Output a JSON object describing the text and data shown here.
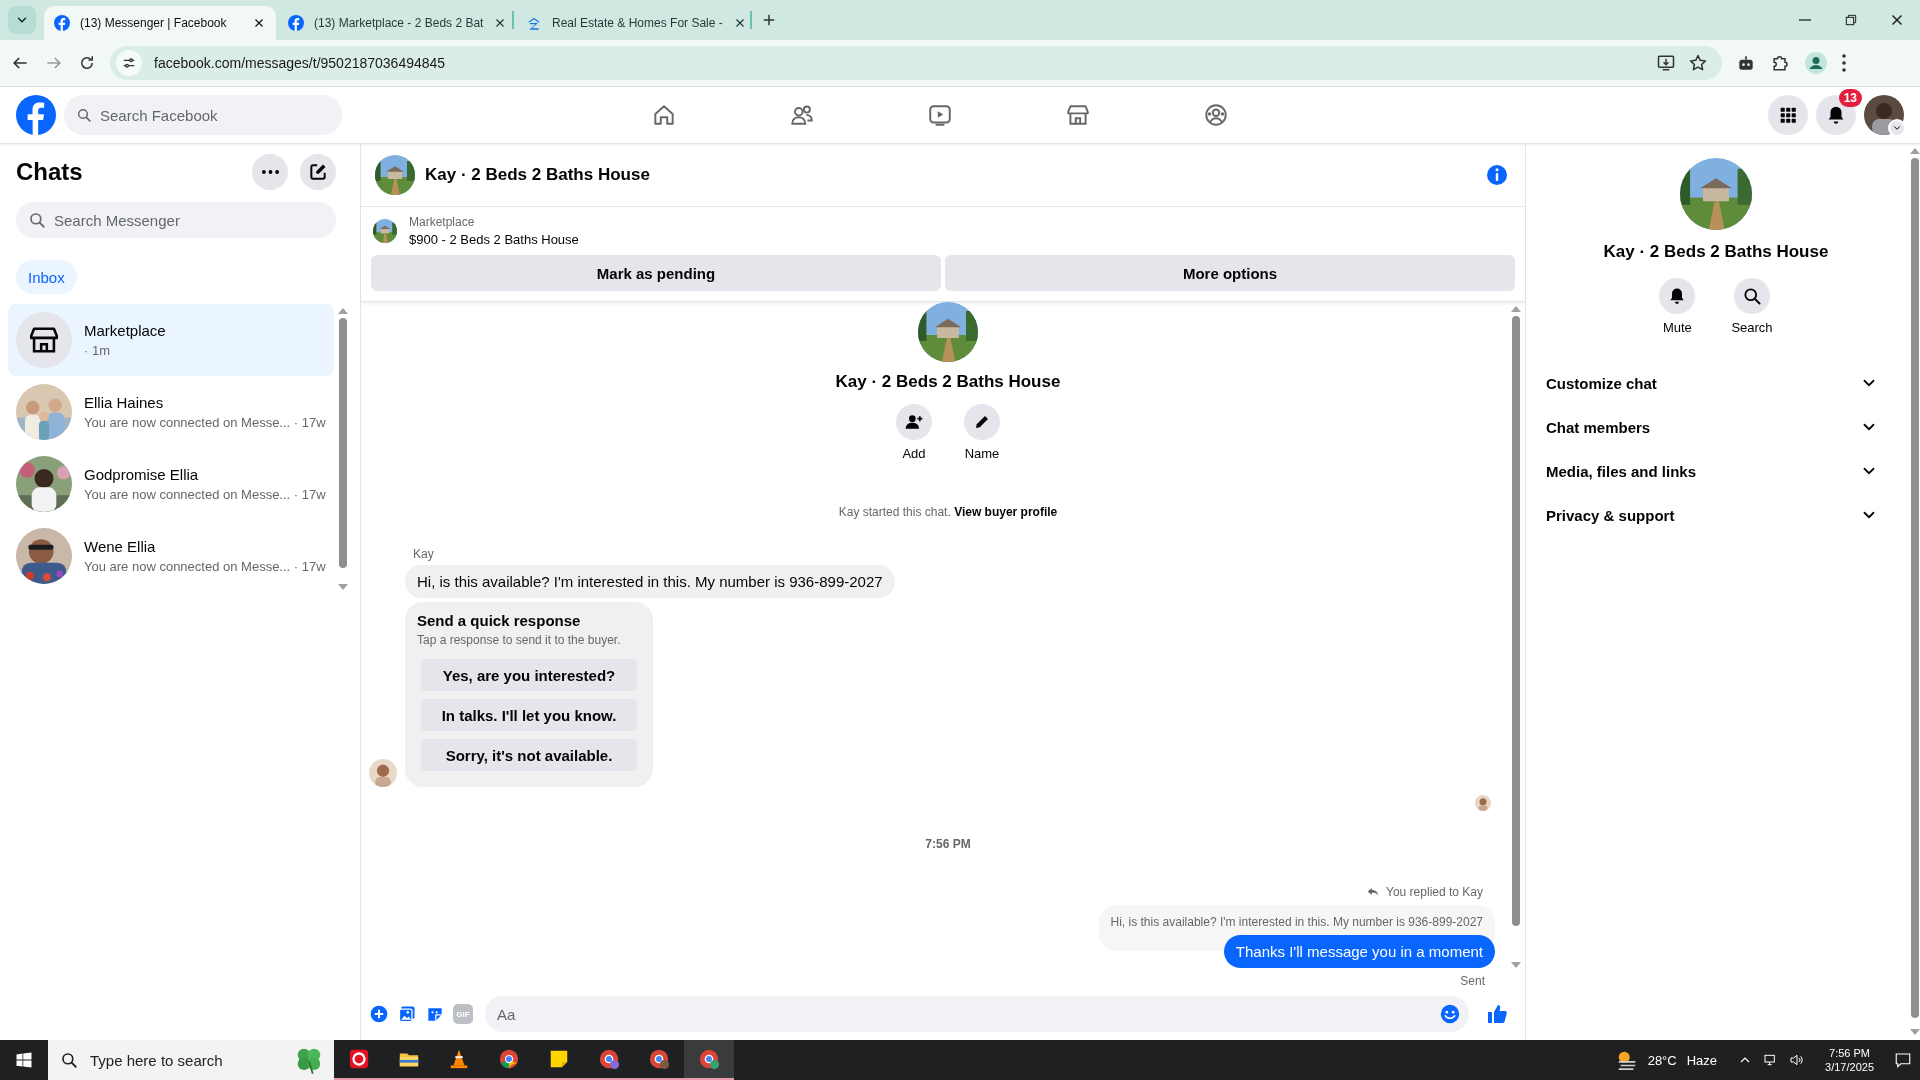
{
  "browser": {
    "tabs": [
      {
        "title": "(13) Messenger | Facebook",
        "selected": true,
        "kind": "facebook"
      },
      {
        "title": "(13) Marketplace - 2 Beds 2 Bat",
        "selected": false,
        "kind": "facebook"
      },
      {
        "title": "Real Estate & Homes For Sale -",
        "selected": false,
        "kind": "house"
      }
    ],
    "url": "facebook.com/messages/t/9502187036494845"
  },
  "header": {
    "search_placeholder": "Search Facebook",
    "notification_count": "13"
  },
  "chats": {
    "title": "Chats",
    "search_placeholder": "Search Messenger",
    "filters": [
      {
        "label": "Inbox",
        "selected": true
      }
    ],
    "conversations": [
      {
        "kind": "store",
        "name": "Marketplace",
        "time": "· 1m",
        "selected": true
      },
      {
        "kind": "picture",
        "name": "Ellia Haines",
        "preview": "You are now connected on Messe...",
        "time": "· 17w",
        "selected": false
      },
      {
        "kind": "picture",
        "name": "Godpromise Ellia",
        "preview": "You are now connected on Messe...",
        "time": "· 17w",
        "selected": false
      },
      {
        "kind": "picture",
        "name": "Wene Ellia",
        "preview": "You are now connected on Messe...",
        "time": "· 17w",
        "selected": false
      }
    ]
  },
  "conversation": {
    "title": "Kay · 2 Beds 2 Baths House",
    "listing": {
      "label": "Marketplace",
      "title": "$900 - 2 Beds 2 Baths House"
    },
    "actions": [
      "Mark as pending",
      "More options"
    ],
    "intro": {
      "title": "Kay · 2 Beds 2 Baths House",
      "actions": [
        {
          "kind": "add",
          "label": "Add"
        },
        {
          "kind": "name",
          "label": "Name"
        }
      ],
      "started": "Kay started this chat.",
      "link": "View buyer profile"
    },
    "sender": "Kay",
    "incoming": "Hi, is this available? I'm interested in this. My number is 936-899-2027",
    "quick_response": {
      "title": "Send a quick response",
      "subtitle": "Tap a response to send it to the buyer.",
      "options": [
        "Yes, are you interested?",
        "In talks. I'll let you know.",
        "Sorry, it's not available."
      ]
    },
    "timestamp": "7:56 PM",
    "reply_label": "You replied to Kay",
    "quoted": "Hi, is this available? I'm interested in this. My number is 936-899-2027",
    "outgoing": "Thanks I'll message you in a moment",
    "status": "Sent",
    "composer": {
      "placeholder": "Aa",
      "gif_label": "GIF"
    }
  },
  "details": {
    "title": "Kay · 2 Beds 2 Baths House",
    "actions": [
      {
        "kind": "mute",
        "label": "Mute"
      },
      {
        "kind": "search",
        "label": "Search"
      }
    ],
    "sections": [
      {
        "label": "Customize chat",
        "expanded": false
      },
      {
        "label": "Chat members",
        "expanded": false
      },
      {
        "label": "Media, files and links",
        "expanded": false
      },
      {
        "label": "Privacy & support",
        "expanded": false
      }
    ]
  },
  "taskbar": {
    "search_placeholder": "Type here to search",
    "temperature": "28°C",
    "weather": "Haze",
    "time": "7:56 PM",
    "date": "3/17/2025"
  }
}
